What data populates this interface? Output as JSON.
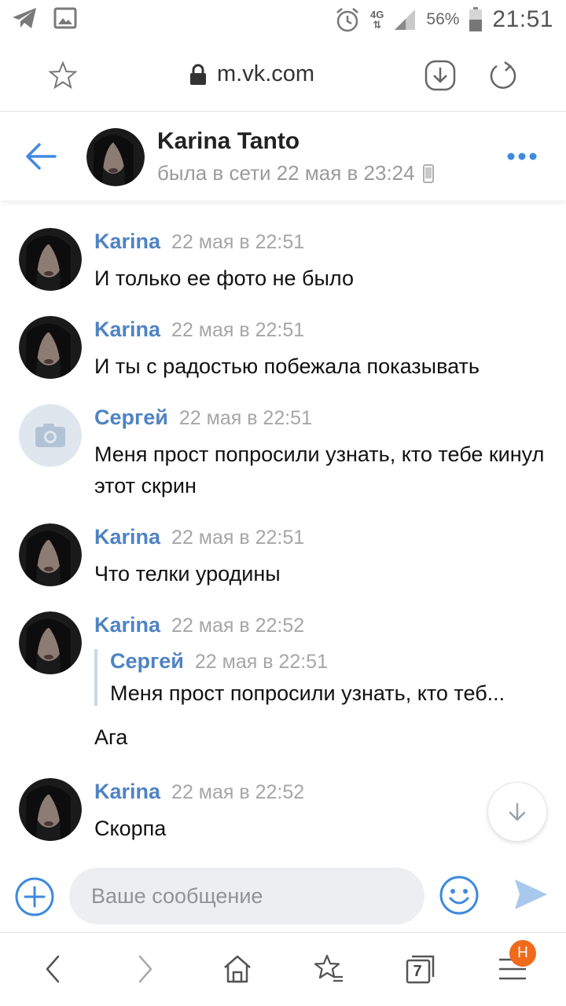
{
  "status_bar": {
    "network": "4G",
    "battery": "56%",
    "time": "21:51"
  },
  "browser": {
    "url": "m.vk.com"
  },
  "chat": {
    "name": "Karina Tanto",
    "status": "была в сети 22 мая в 23:24"
  },
  "messages": [
    {
      "author": "Karina",
      "time": "22 мая в 22:51",
      "text": "И только ее фото не было"
    },
    {
      "author": "Karina",
      "time": "22 мая в 22:51",
      "text": "И ты с радостью побежала показывать"
    },
    {
      "author": "Сергей",
      "time": "22 мая в 22:51",
      "text": "Меня прост попросили узнать, кто тебе кинул этот скрин"
    },
    {
      "author": "Karina",
      "time": "22 мая в 22:51",
      "text": "Что телки уродины"
    },
    {
      "author": "Karina",
      "time": "22 мая в 22:52",
      "text": "Ага",
      "forwarded": {
        "author": "Сергей",
        "time": "22 мая в 22:51",
        "text": "Меня прост попросили узнать, кто теб..."
      }
    },
    {
      "author": "Karina",
      "time": "22 мая в 22:52",
      "text": "Скорпа"
    }
  ],
  "composer": {
    "placeholder": "Ваше сообщение"
  },
  "bottom_nav": {
    "tab_count": "7",
    "menu_badge": "Н"
  },
  "colors": {
    "accent": "#4f83c4",
    "icon_blue": "#3f8ae0",
    "badge": "#f06a1c"
  }
}
